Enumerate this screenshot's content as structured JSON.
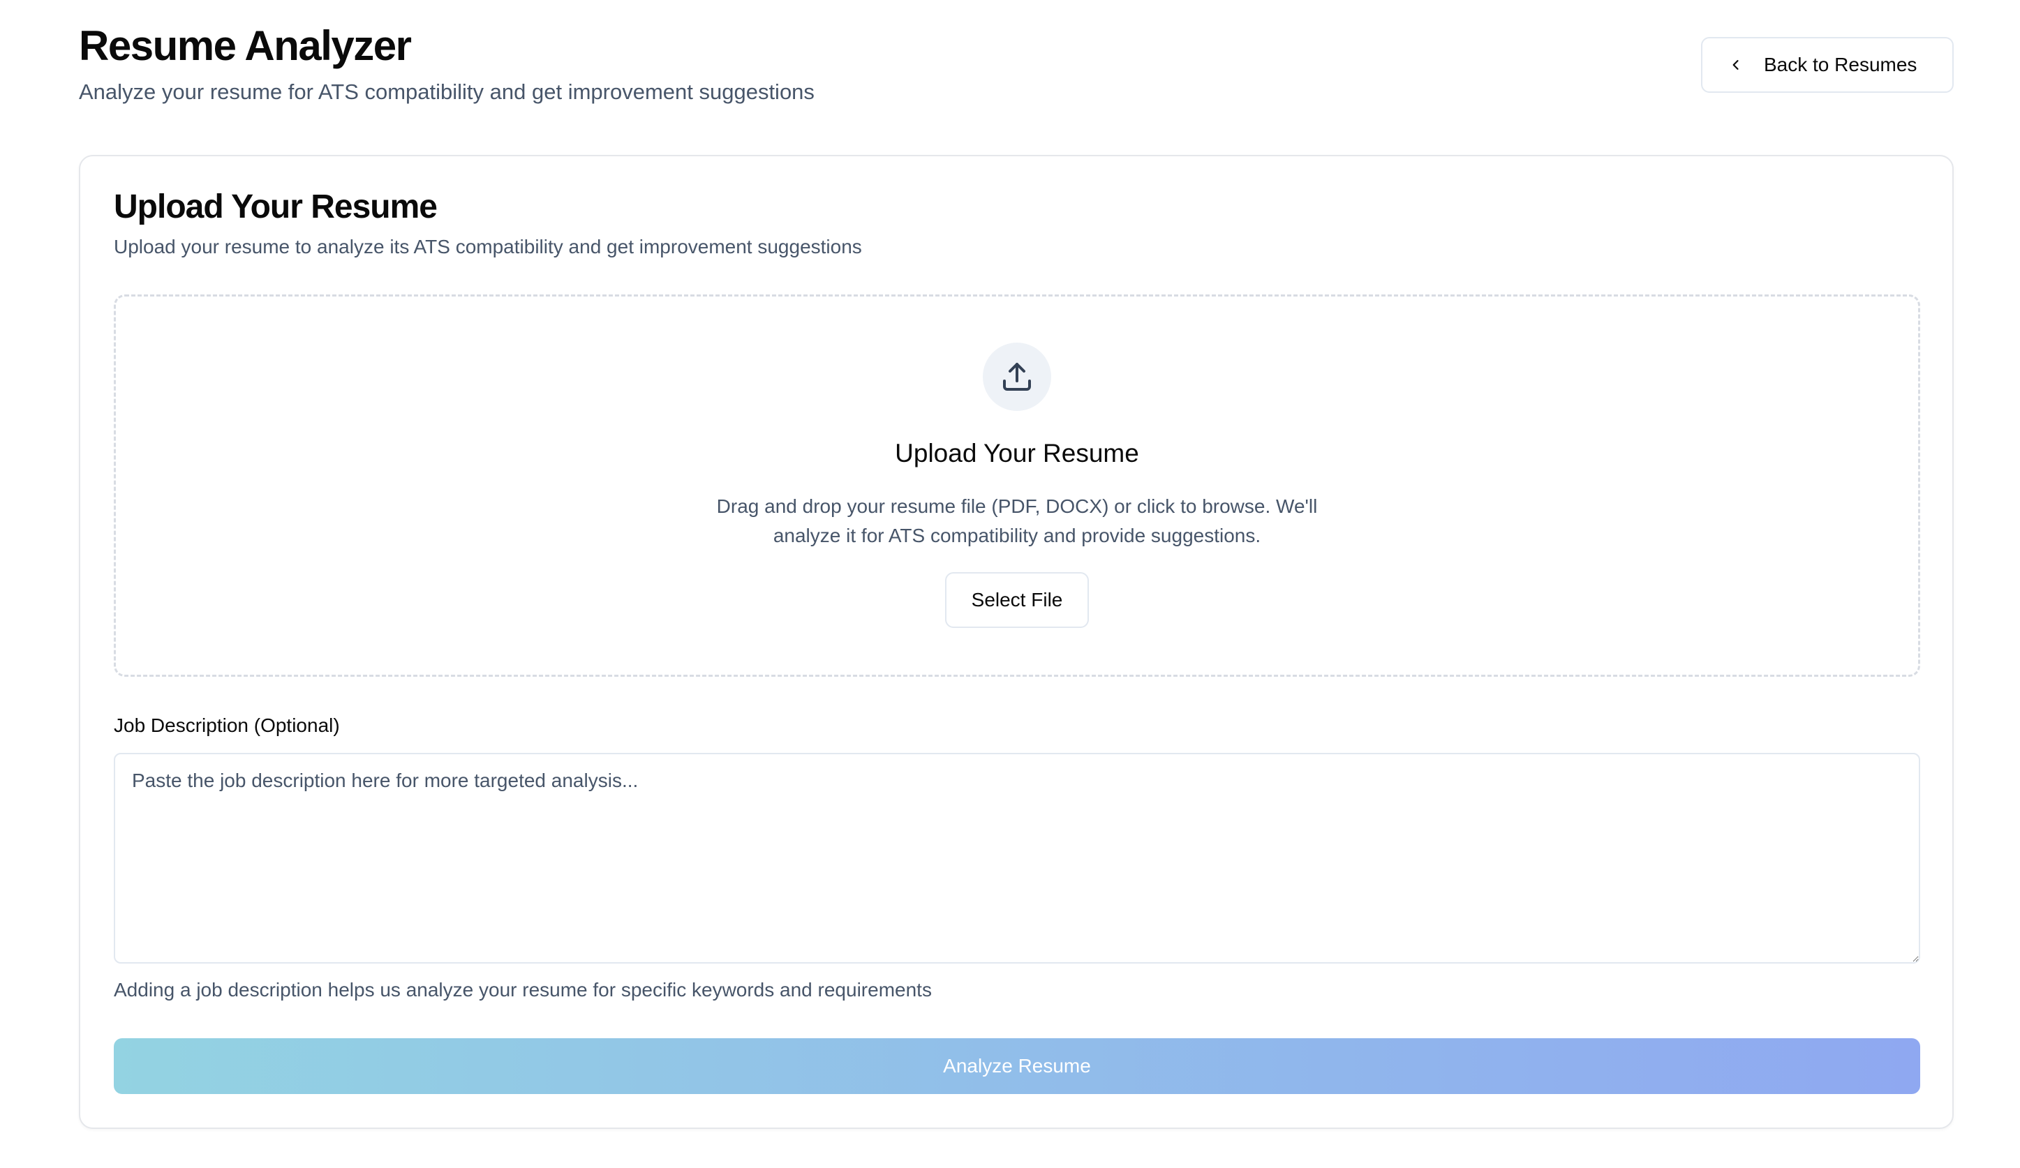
{
  "header": {
    "title": "Resume Analyzer",
    "subtitle": "Analyze your resume for ATS compatibility and get improvement suggestions",
    "back_button_label": "Back to Resumes",
    "back_button_icon": "chevron-left-icon"
  },
  "card": {
    "title": "Upload Your Resume",
    "description": "Upload your resume to analyze its ATS compatibility and get improvement suggestions"
  },
  "dropzone": {
    "icon": "upload-icon",
    "title": "Upload Your Resume",
    "description": "Drag and drop your resume file (PDF, DOCX) or click to browse. We'll analyze it for ATS compatibility and provide suggestions.",
    "select_file_label": "Select File"
  },
  "job_description": {
    "label": "Job Description (Optional)",
    "value": "",
    "placeholder": "Paste the job description here for more targeted analysis...",
    "hint": "Adding a job description helps us analyze your resume for specific keywords and requirements"
  },
  "analyze": {
    "label": "Analyze Resume",
    "disabled": true,
    "gradient_start": "#93d3e2",
    "gradient_end": "#8fa8f1"
  },
  "colors": {
    "text_primary": "#0a0a0a",
    "text_muted": "#475569",
    "border": "#e2e8f0",
    "upload_circle_bg": "#eef2f7"
  }
}
